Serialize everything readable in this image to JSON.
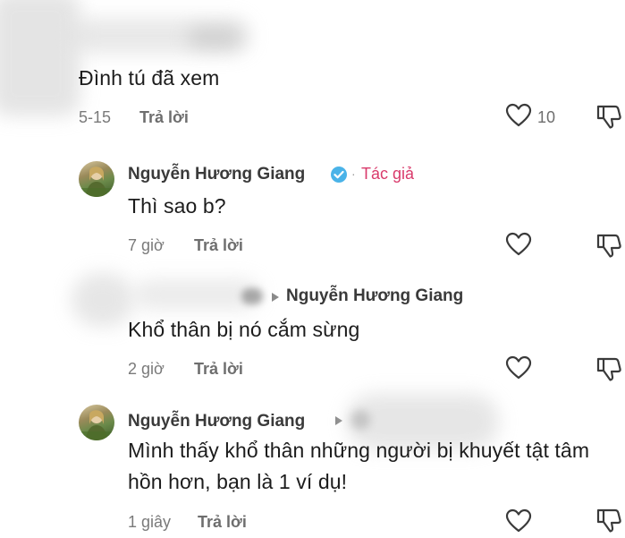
{
  "comments": [
    {
      "text": "Đình tú đã xem",
      "time": "5-15",
      "reply_label": "Trả lời",
      "like_count": "10"
    },
    {
      "username": "Nguyễn Hương Giang",
      "author_tag": "Tác giả",
      "separator": "·",
      "text": "Thì sao b?",
      "time": "7 giờ",
      "reply_label": "Trả lời"
    },
    {
      "reply_to": "Nguyễn Hương Giang",
      "text": "Khổ thân bị nó cắm sừng",
      "time": "2 giờ",
      "reply_label": "Trả lời"
    },
    {
      "username": "Nguyễn Hương Giang",
      "text": "Mình thấy khổ thân những người bị khuyết tật tâm hồn hơn, bạn là 1 ví dụ!",
      "time": "1 giây",
      "reply_label": "Trả lời"
    }
  ],
  "icons": {
    "like": "heart-outline-icon",
    "dislike": "thumbs-down-icon",
    "verified": "verified-badge-icon",
    "reply_arrow": "reply-arrow-icon"
  },
  "colors": {
    "author_tag": "#d93a6b",
    "verified_badge": "#4ab3e8",
    "icon_stroke": "#3a3a3a"
  }
}
